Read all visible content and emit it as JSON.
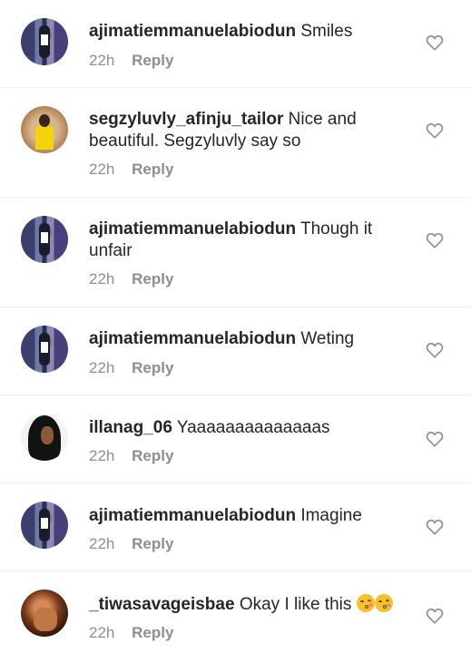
{
  "comments": [
    {
      "username": "ajimatiemmanuelabiodun",
      "text": "Smiles",
      "time": "22h",
      "reply": "Reply",
      "avatar": "avatar-ajimati"
    },
    {
      "username": "segzyluvly_afinju_tailor",
      "text": "Nice and beautiful. Segzyluvly say so",
      "time": "22h",
      "reply": "Reply",
      "avatar": "avatar-segzyluvly"
    },
    {
      "username": "ajimatiemmanuelabiodun",
      "text": "Though it unfair",
      "time": "22h",
      "reply": "Reply",
      "avatar": "avatar-ajimati"
    },
    {
      "username": "ajimatiemmanuelabiodun",
      "text": "Weting",
      "time": "22h",
      "reply": "Reply",
      "avatar": "avatar-ajimati"
    },
    {
      "username": "illanag_06",
      "text": "Yaaaaaaaaaaaaaas",
      "time": "22h",
      "reply": "Reply",
      "avatar": "avatar-illanag"
    },
    {
      "username": "ajimatiemmanuelabiodun",
      "text": "Imagine",
      "time": "22h",
      "reply": "Reply",
      "avatar": "avatar-ajimati"
    },
    {
      "username": "_tiwasavageisbae",
      "text": "Okay I  like this",
      "emojis": [
        "kissing-face-emoji",
        "kissing-face-emoji"
      ],
      "time": "22h",
      "reply": "Reply",
      "avatar": "avatar-tiwa"
    }
  ],
  "icons": {
    "like": "heart-outline-icon"
  },
  "colors": {
    "text": "#262626",
    "muted": "#8e8e8e",
    "divider": "#efefef"
  }
}
